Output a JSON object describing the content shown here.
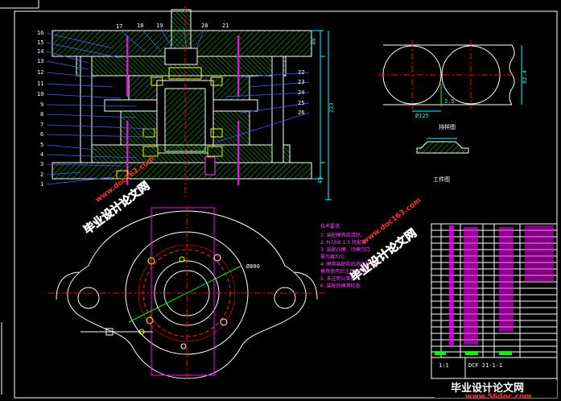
{
  "parts_left": [
    "16",
    "15",
    "14",
    "13",
    "12",
    "11",
    "10",
    "9",
    "8",
    "7",
    "6",
    "5",
    "4",
    "3",
    "2",
    "1"
  ],
  "parts_top": [
    "17",
    "18",
    "19",
    "20",
    "21"
  ],
  "parts_right": [
    "22",
    "23",
    "24",
    "25",
    "26"
  ],
  "dims": {
    "d1": "40",
    "d2": "223",
    "d3": "45",
    "bore": "Ø800",
    "strip_w": "82.4",
    "strip_h": "Ø125",
    "side": "2.5"
  },
  "captions": {
    "strip": "排样图",
    "workpiece": "工件图"
  },
  "tech": {
    "title": "技术要求:",
    "lines": [
      "1. 装配模具前清除。",
      "2. H7/h6 1:5 持配套.",
      "3. 装配凸模，凹模刃口",
      "   需刃磨均匀.",
      "4. 模具装配前后进行检查",
      "   模具使用后注意保养",
      "5. 未注明公差按.",
      "6. 装配后模具检查."
    ]
  },
  "title_block": {
    "scale": "1:1",
    "code": "DCF 21-1-1"
  },
  "watermark": {
    "brand": "毕业设计论文网",
    "url": "www.doc163.com",
    "footer_url": "www.56doc.com"
  },
  "colors": {
    "line": "#ffffff",
    "hatch": "#00ff00",
    "center": "#ff0000",
    "dim": "#00ffff",
    "part": "#ffff00",
    "bolt": "#ff00ff",
    "leader": "#4040ff"
  }
}
